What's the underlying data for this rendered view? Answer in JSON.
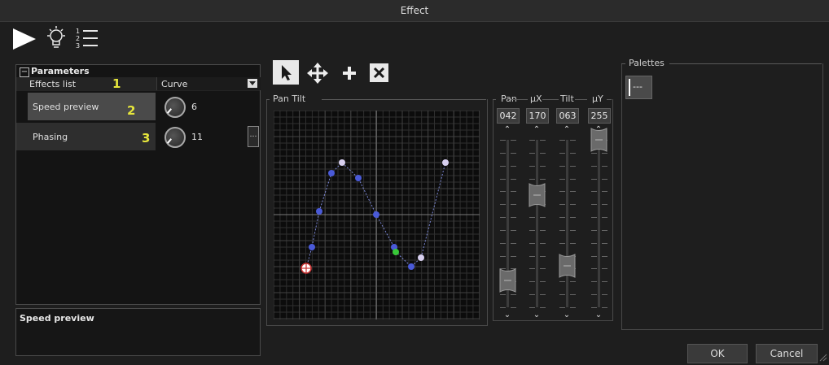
{
  "window": {
    "title": "Effect"
  },
  "toolbar": {
    "icons": [
      "play-icon",
      "bulb-icon",
      "numbered-list-icon"
    ]
  },
  "parameters": {
    "header": "Parameters",
    "rows": [
      {
        "label": "Effects list",
        "marker": "1",
        "value": "Curve"
      },
      {
        "label": "Speed preview",
        "marker": "2",
        "value": "6"
      },
      {
        "label": "Phasing",
        "marker": "3",
        "value": "11"
      }
    ]
  },
  "description": {
    "title": "Speed preview"
  },
  "curve_tools": {
    "icons": [
      "pointer-icon",
      "move-icon",
      "add-icon",
      "delete-icon"
    ]
  },
  "pan_tilt": {
    "label": "Pan Tilt"
  },
  "faders": [
    {
      "label": "Pan",
      "value": "042",
      "level": 0.16
    },
    {
      "label": "µX",
      "value": "170",
      "level": 0.67
    },
    {
      "label": "Tilt",
      "value": "063",
      "level": 0.25
    },
    {
      "label": "µY",
      "value": "255",
      "level": 1.0
    }
  ],
  "palettes": {
    "label": "Palettes",
    "item": "---"
  },
  "buttons": {
    "ok": "OK",
    "cancel": "Cancel"
  },
  "colors": {
    "point": "#4a5ad8",
    "point_light": "#d8d0f0",
    "point_green": "#38c838",
    "accent_yellow": "#e6e63c"
  }
}
